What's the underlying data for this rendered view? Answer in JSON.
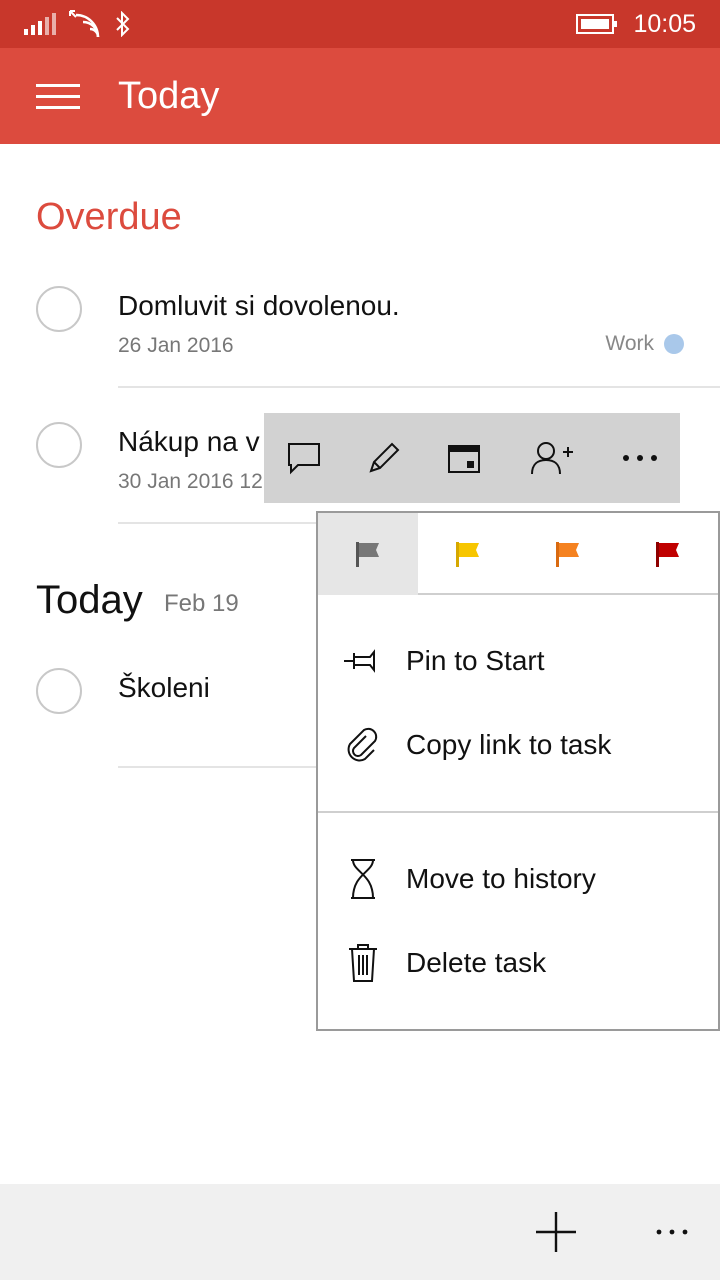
{
  "status_bar": {
    "time": "10:05",
    "icons": [
      "signal-icon",
      "wifi-icon",
      "bluetooth-icon",
      "battery-icon"
    ]
  },
  "app_bar": {
    "title": "Today",
    "menu_icon": "hamburger-icon"
  },
  "sections": {
    "overdue": {
      "title": "Overdue",
      "tasks": [
        {
          "title": "Domluvit si dovolenou.",
          "date": "26 Jan 2016",
          "list": "Work"
        },
        {
          "title": "Nákup na v",
          "date": "30 Jan 2016 12"
        }
      ]
    },
    "today": {
      "title": "Today",
      "date": "Feb 19",
      "tasks": [
        {
          "title": "Školeni"
        }
      ]
    }
  },
  "context_toolbar": {
    "actions": [
      "comment-icon",
      "edit-icon",
      "calendar-icon",
      "assign-person-icon",
      "more-icon"
    ]
  },
  "menu": {
    "flags": [
      {
        "name": "flag-none-icon",
        "color": "#777777",
        "selected": true
      },
      {
        "name": "flag-yellow-icon",
        "color": "#f7c600"
      },
      {
        "name": "flag-orange-icon",
        "color": "#f58220"
      },
      {
        "name": "flag-red-icon",
        "color": "#c00000"
      }
    ],
    "items": {
      "pin": {
        "label": "Pin to Start",
        "icon": "pin-icon"
      },
      "copy_link": {
        "label": "Copy link to task",
        "icon": "link-icon"
      },
      "history": {
        "label": "Move to history",
        "icon": "hourglass-icon"
      },
      "delete": {
        "label": "Delete task",
        "icon": "trash-icon"
      }
    }
  },
  "bottom_bar": {
    "actions": [
      "add-icon",
      "more-icon"
    ]
  },
  "colors": {
    "status_bar": "#c8372b",
    "app_bar": "#dc4b3e",
    "accent": "#dc4b3e",
    "list_dot": "#a9c8ea"
  }
}
